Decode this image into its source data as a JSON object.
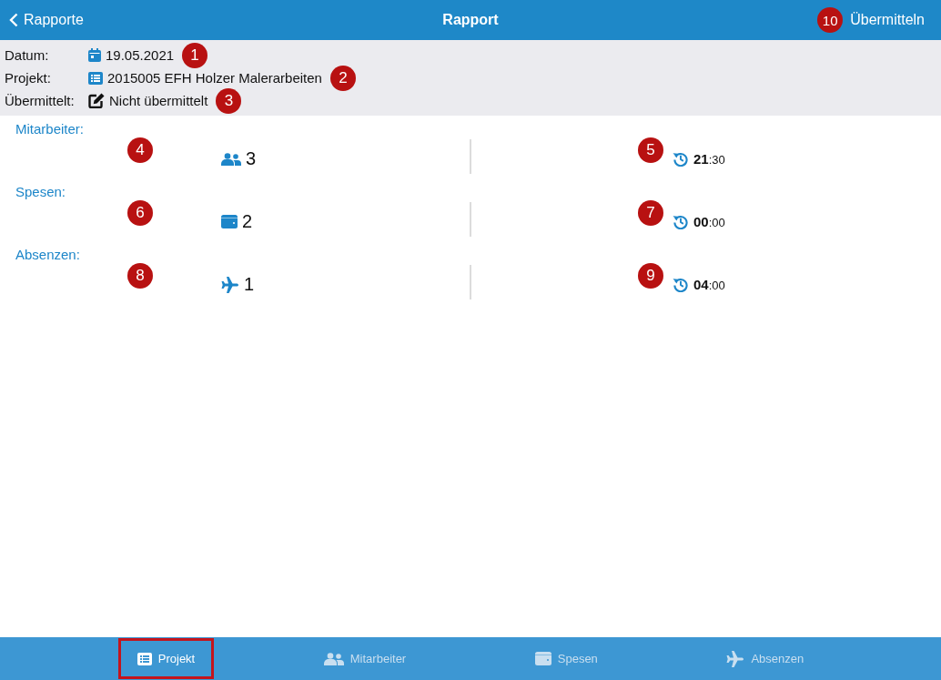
{
  "nav_bar": {
    "back_label": "Rapporte",
    "title": "Rapport",
    "action_label": "Übermitteln",
    "action_callout": "10"
  },
  "info": [
    {
      "kind": "date",
      "label": "Datum:",
      "value": "19.05.2021",
      "callout": "1"
    },
    {
      "kind": "project",
      "label": "Projekt:",
      "value": "2015005 EFH Holzer Malerarbeiten",
      "callout": "2"
    },
    {
      "kind": "status",
      "label": "Übermittelt:",
      "value": "Nicht übermittelt",
      "callout": "3"
    }
  ],
  "sections": [
    {
      "kind": "staff",
      "title": "Mitarbeiter:",
      "count": "3",
      "count_callout": "4",
      "time": "**21**:30",
      "time_callout": "5"
    },
    {
      "kind": "expenses",
      "title": "Spesen:",
      "count": "2",
      "count_callout": "6",
      "time": "**00**:00",
      "time_callout": "7"
    },
    {
      "kind": "absences",
      "title": "Absenzen:",
      "count": "1",
      "count_callout": "8",
      "time": "**04**:00",
      "time_callout": "9"
    }
  ],
  "tab_bar": [
    {
      "kind": "project",
      "label": "Projekt",
      "selected": true
    },
    {
      "kind": "staff",
      "label": "Mitarbeiter",
      "selected": false
    },
    {
      "kind": "expenses",
      "label": "Spesen",
      "selected": false
    },
    {
      "kind": "absences",
      "label": "Absenzen",
      "selected": false
    }
  ]
}
